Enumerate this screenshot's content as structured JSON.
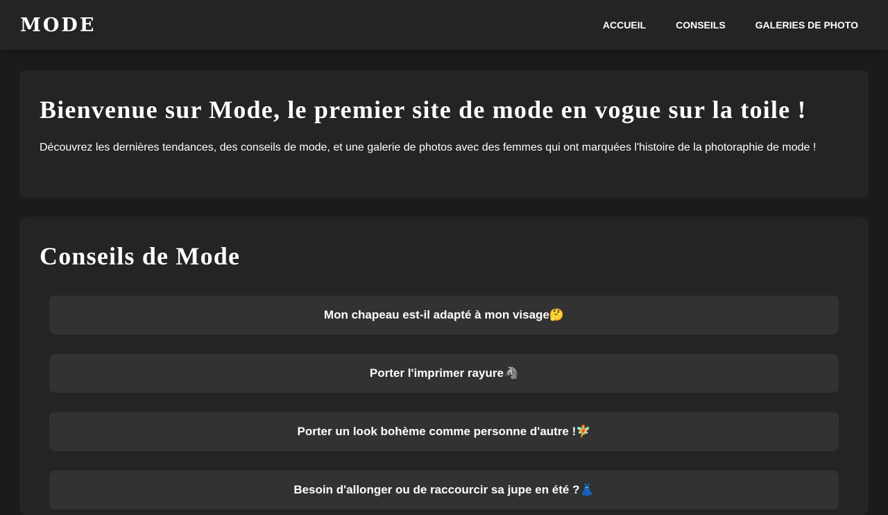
{
  "brand": {
    "logo": "MODE"
  },
  "nav": {
    "links": [
      {
        "label": "ACCUEIL"
      },
      {
        "label": "CONSEILS"
      },
      {
        "label": "GALERIES DE PHOTO"
      }
    ]
  },
  "hero": {
    "title": "Bienvenue sur Mode, le premier site de mode en vogue sur la toile !",
    "text": "Découvrez les dernières tendances, des conseils de mode, et une galerie de photos avec des femmes qui ont marquées l'histoire de la photoraphie de mode !"
  },
  "tips": {
    "title": "Conseils de Mode",
    "items": [
      {
        "label": "Mon chapeau est-il adapté à mon visage🤔"
      },
      {
        "label": "Porter l'imprimer rayure🦓"
      },
      {
        "label": "Porter un look bohème comme personne d'autre !🧚"
      },
      {
        "label": "Besoin d'allonger ou de raccourcir sa jupe en été ?👗"
      }
    ]
  },
  "colors": {
    "background": "#1b1b1b",
    "surface": "#242424",
    "button": "#323232",
    "text": "#ffffff"
  }
}
